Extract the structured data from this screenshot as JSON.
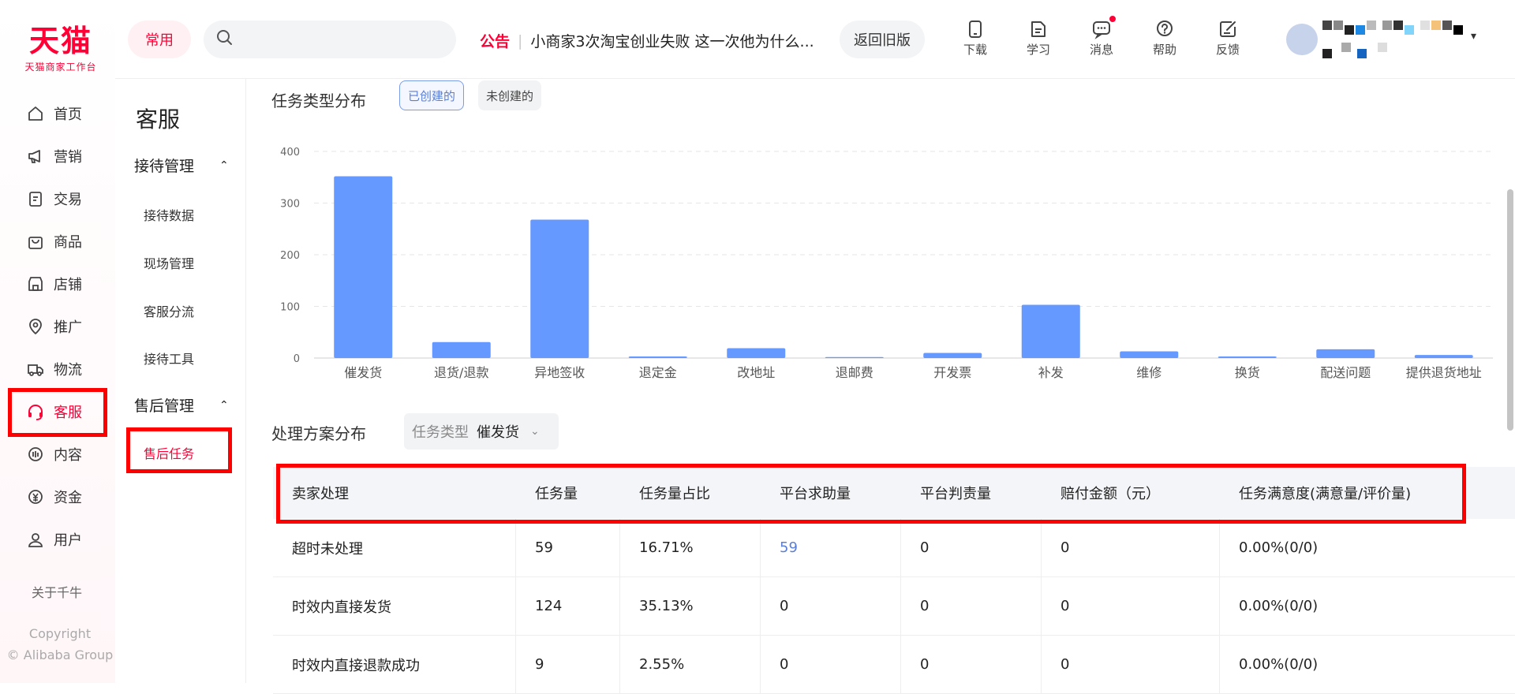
{
  "brand": {
    "name": "天猫",
    "subtitle": "天猫商家工作台",
    "color": "#ff0036"
  },
  "leftnav": {
    "items": [
      {
        "label": "首页",
        "icon": "home-icon"
      },
      {
        "label": "营销",
        "icon": "megaphone-icon"
      },
      {
        "label": "交易",
        "icon": "order-icon"
      },
      {
        "label": "商品",
        "icon": "bag-icon"
      },
      {
        "label": "店铺",
        "icon": "store-icon"
      },
      {
        "label": "推广",
        "icon": "location-icon"
      },
      {
        "label": "物流",
        "icon": "truck-icon"
      },
      {
        "label": "客服",
        "icon": "headset-icon",
        "active": true
      },
      {
        "label": "内容",
        "icon": "content-icon"
      },
      {
        "label": "资金",
        "icon": "yuan-icon"
      },
      {
        "label": "用户",
        "icon": "user-icon"
      }
    ],
    "about": "关于千牛",
    "copyright_line1": "Copyright",
    "copyright_line2": "© Alibaba Group"
  },
  "subnav": {
    "title": "客服",
    "groups": [
      {
        "label": "接待管理",
        "items": [
          "接待数据",
          "现场管理",
          "客服分流",
          "接待工具"
        ]
      },
      {
        "label": "售后管理",
        "items": [
          "售后任务"
        ],
        "active_item": "售后任务"
      }
    ]
  },
  "header": {
    "common_label": "常用",
    "search_placeholder": "",
    "notice_tag": "公告",
    "notice_text": "小商家3次淘宝创业失败 这一次他为什么...",
    "old_version_label": "返回旧版",
    "icons": [
      {
        "label": "下载",
        "icon": "download-phone-icon"
      },
      {
        "label": "学习",
        "icon": "learn-icon"
      },
      {
        "label": "消息",
        "icon": "message-icon",
        "badge": true
      },
      {
        "label": "帮助",
        "icon": "help-icon"
      },
      {
        "label": "反馈",
        "icon": "feedback-icon"
      }
    ]
  },
  "main": {
    "task_type_title": "任务类型分布",
    "chips": [
      {
        "label": "已创建的",
        "active": true
      },
      {
        "label": "未创建的",
        "active": false
      }
    ],
    "plan_title": "处理方案分布",
    "select_label": "任务类型",
    "select_value": "催发货",
    "table": {
      "headers": [
        "卖家处理",
        "任务量",
        "任务量占比",
        "平台求助量",
        "平台判责量",
        "赔付金额（元）",
        "任务满意度(满意量/评价量)"
      ],
      "rows": [
        [
          "超时未处理",
          "59",
          "16.71%",
          "59",
          "0",
          "0",
          "0.00%(0/0)"
        ],
        [
          "时效内直接发货",
          "124",
          "35.13%",
          "0",
          "0",
          "0",
          "0.00%(0/0)"
        ],
        [
          "时效内直接退款成功",
          "9",
          "2.55%",
          "0",
          "0",
          "0",
          "0.00%(0/0)"
        ]
      ]
    }
  },
  "chart_data": {
    "type": "bar",
    "categories": [
      "催发货",
      "退货/退款",
      "异地签收",
      "退定金",
      "改地址",
      "退邮费",
      "开发票",
      "补发",
      "维修",
      "换货",
      "配送问题",
      "提供退货地址"
    ],
    "values": [
      352,
      31,
      268,
      3,
      19,
      2,
      10,
      103,
      13,
      3,
      17,
      6
    ],
    "ylim": [
      0,
      400
    ],
    "yticks": [
      0,
      100,
      200,
      300,
      400
    ],
    "grid": true,
    "bar_color": "#6699ff"
  }
}
